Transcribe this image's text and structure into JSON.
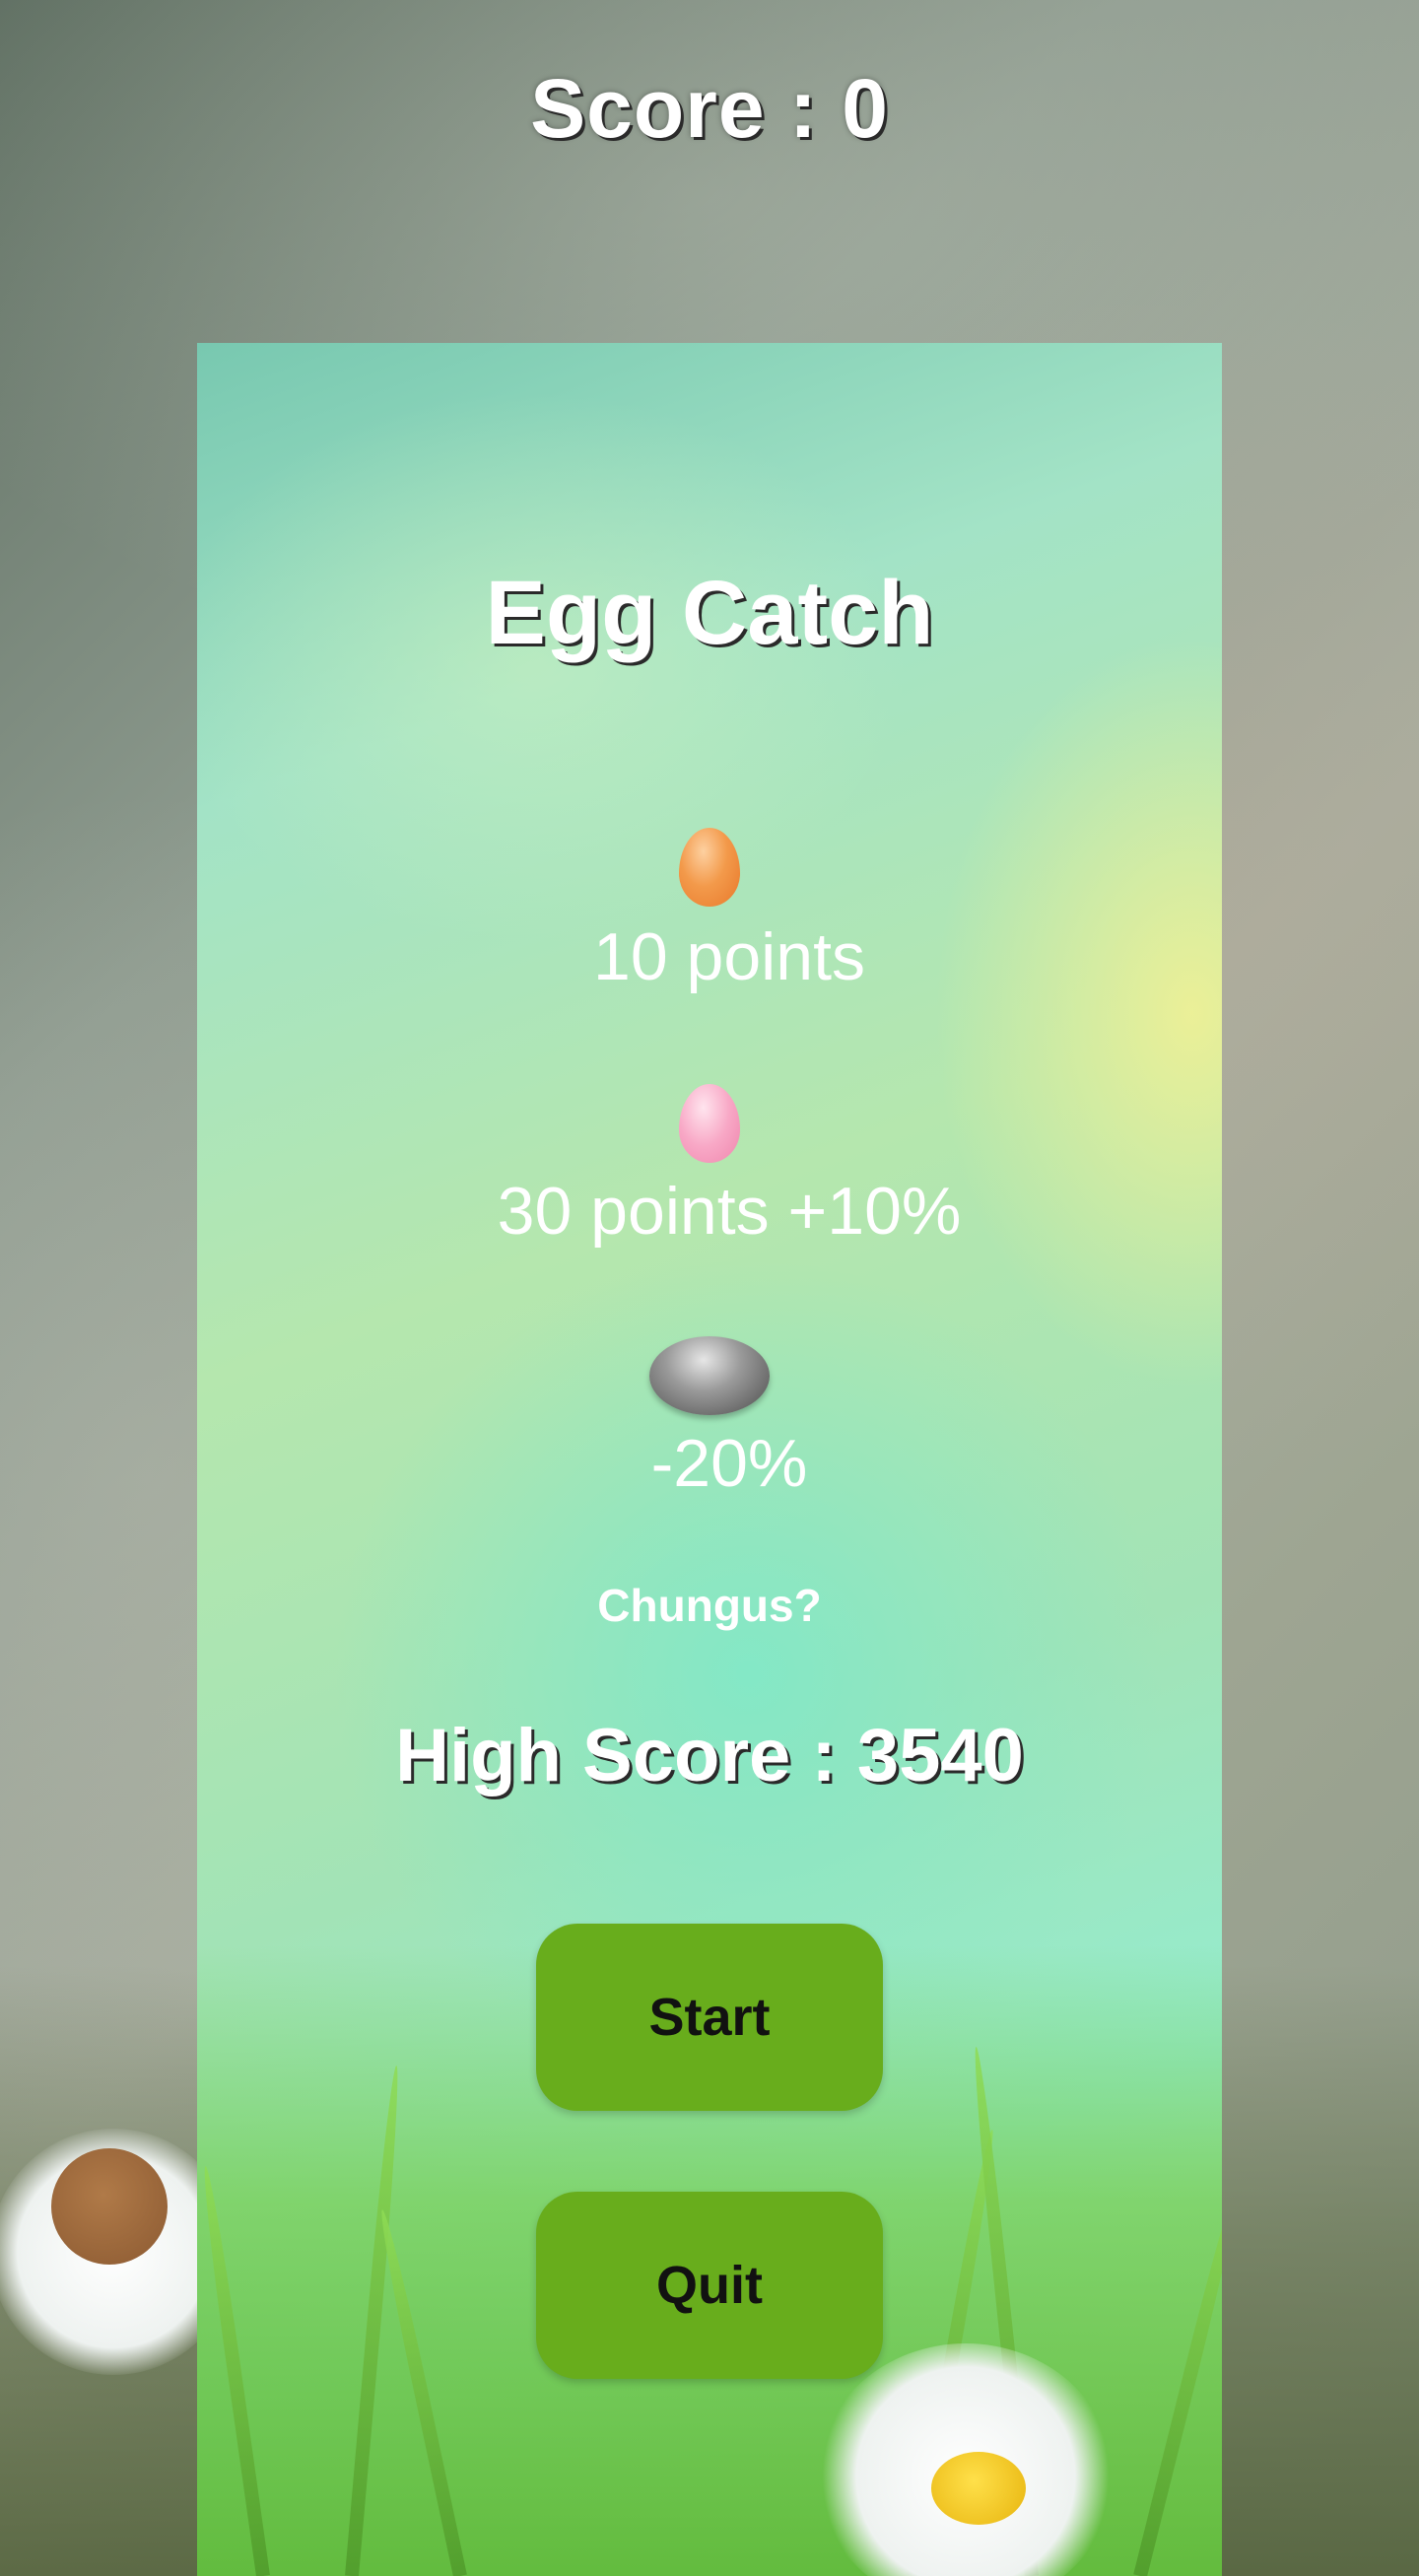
{
  "hud": {
    "score_text": "Score : 0"
  },
  "menu": {
    "title": "Egg Catch",
    "items": [
      {
        "icon": "orange-egg-icon",
        "text": "10 points"
      },
      {
        "icon": "pink-egg-icon",
        "text": "30 points +10%"
      },
      {
        "icon": "stone-icon",
        "text": "-20%"
      }
    ],
    "link_text": "Chungus?",
    "high_score_text": "High Score : 3540",
    "start_label": "Start",
    "quit_label": "Quit"
  },
  "colors": {
    "button": "#68ad1c",
    "button_text": "#111111",
    "panel_tint": "#a3e3c6"
  }
}
